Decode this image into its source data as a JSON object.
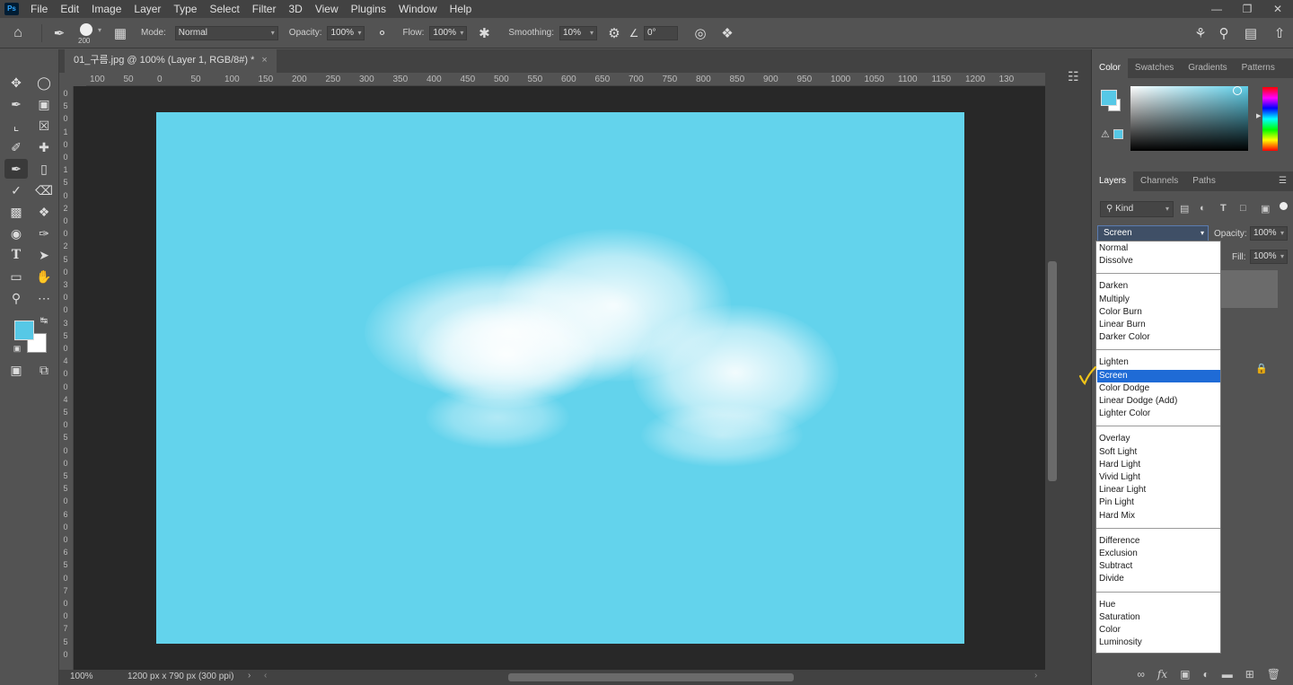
{
  "menubar": {
    "app_badge": "Ps",
    "items": [
      "File",
      "Edit",
      "Image",
      "Layer",
      "Type",
      "Select",
      "Filter",
      "3D",
      "View",
      "Plugins",
      "Window",
      "Help"
    ]
  },
  "options": {
    "brush_size": "200",
    "mode_label": "Mode:",
    "mode_value": "Normal",
    "opacity_label": "Opacity:",
    "opacity_value": "100%",
    "flow_label": "Flow:",
    "flow_value": "100%",
    "smoothing_label": "Smoothing:",
    "smoothing_value": "10%",
    "angle_value": "0°"
  },
  "document": {
    "tab_title": "01_구름.jpg @ 100% (Layer 1, RGB/8#) *",
    "zoom": "100%",
    "doc_info": "1200 px x 790 px (300 ppi)",
    "canvas_color": "#63d3ec"
  },
  "ruler": {
    "h_ticks": [
      "100",
      "50",
      "0",
      "50",
      "100",
      "150",
      "200",
      "250",
      "300",
      "350",
      "400",
      "450",
      "500",
      "550",
      "600",
      "650",
      "700",
      "750",
      "800",
      "850",
      "900",
      "950",
      "1000",
      "1050",
      "1100",
      "1150",
      "1200",
      "130"
    ],
    "v_ticks": [
      "0",
      "5",
      "0",
      "1",
      "0",
      "0",
      "1",
      "5",
      "0",
      "2",
      "0",
      "0",
      "2",
      "5",
      "0",
      "3",
      "0",
      "0",
      "3",
      "5",
      "0",
      "4",
      "0",
      "0",
      "4",
      "5",
      "0",
      "5",
      "0",
      "0",
      "5",
      "5",
      "0",
      "6",
      "0",
      "0",
      "6",
      "5",
      "0",
      "7",
      "0",
      "0",
      "7",
      "5",
      "0"
    ]
  },
  "colors": {
    "foreground": "#56c8e6",
    "background": "#ffffff",
    "selection": "#1f6bd6",
    "check_mark": "#f0c419"
  },
  "color_panel": {
    "tabs": [
      "Color",
      "Swatches",
      "Gradients",
      "Patterns"
    ]
  },
  "layers_panel": {
    "tabs": [
      "Layers",
      "Channels",
      "Paths"
    ],
    "kind_filter": "Kind",
    "blend_mode": "Screen",
    "opacity_label": "Opacity:",
    "opacity_value": "100%",
    "fill_label": "Fill:",
    "fill_value": "100%"
  },
  "blend_menu": {
    "groups": [
      [
        "Normal",
        "Dissolve"
      ],
      [
        "Darken",
        "Multiply",
        "Color Burn",
        "Linear Burn",
        "Darker Color"
      ],
      [
        "Lighten",
        "Screen",
        "Color Dodge",
        "Linear Dodge (Add)",
        "Lighter Color"
      ],
      [
        "Overlay",
        "Soft Light",
        "Hard Light",
        "Vivid Light",
        "Linear Light",
        "Pin Light",
        "Hard Mix"
      ],
      [
        "Difference",
        "Exclusion",
        "Subtract",
        "Divide"
      ],
      [
        "Hue",
        "Saturation",
        "Color",
        "Luminosity"
      ]
    ],
    "selected": "Screen"
  },
  "icons": {
    "home": "home-icon",
    "brush": "brush-icon",
    "settings": "gear-icon",
    "search": "search-icon",
    "share": "share-icon",
    "lock": "lock-icon",
    "link": "link-icon",
    "fx": "fx-icon",
    "trash": "trash-icon"
  }
}
